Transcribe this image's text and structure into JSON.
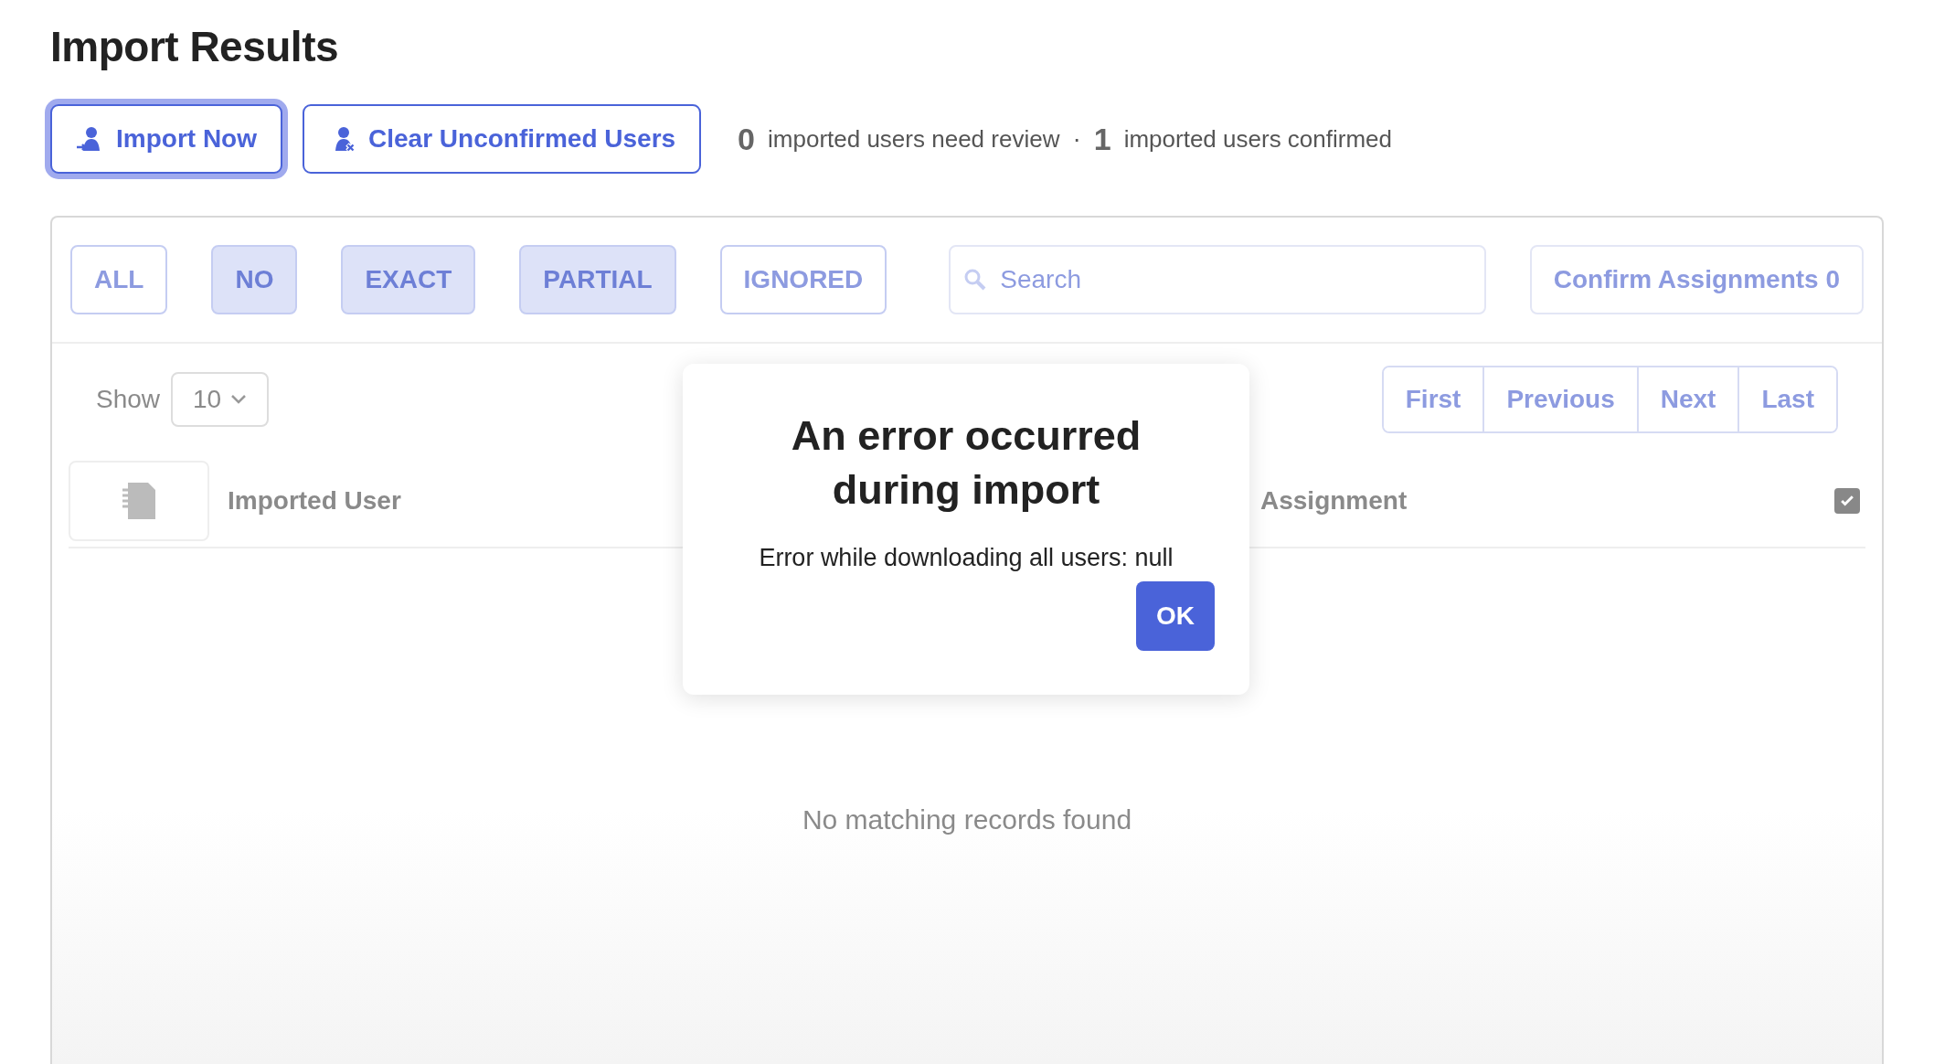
{
  "page": {
    "title": "Import Results"
  },
  "actions": [
    {
      "label": "Import Now",
      "kind": "import",
      "focused": true
    },
    {
      "label": "Clear Unconfirmed Users",
      "kind": "clear",
      "focused": false
    }
  ],
  "summary": {
    "separator": "·",
    "items": [
      {
        "count": "0",
        "label": "imported users need review"
      },
      {
        "count": "1",
        "label": "imported users confirmed"
      }
    ]
  },
  "filters": [
    {
      "label": "ALL",
      "selected": false
    },
    {
      "label": "NO",
      "selected": true
    },
    {
      "label": "EXACT",
      "selected": true
    },
    {
      "label": "PARTIAL",
      "selected": true
    },
    {
      "label": "IGNORED",
      "selected": false
    }
  ],
  "search": {
    "placeholder": "Search"
  },
  "confirm_button": {
    "label": "Confirm Assignments 0"
  },
  "page_size": {
    "label": "Show",
    "value": "10"
  },
  "pagination": [
    "First",
    "Previous",
    "Next",
    "Last"
  ],
  "table": {
    "columns": [
      "Imported User",
      "Assignment"
    ],
    "select_all_checked": true,
    "empty_message": "No matching records found"
  },
  "dialog": {
    "title": "An error occurred during import",
    "message": "Error while downloading all users: null",
    "button": "OK"
  }
}
